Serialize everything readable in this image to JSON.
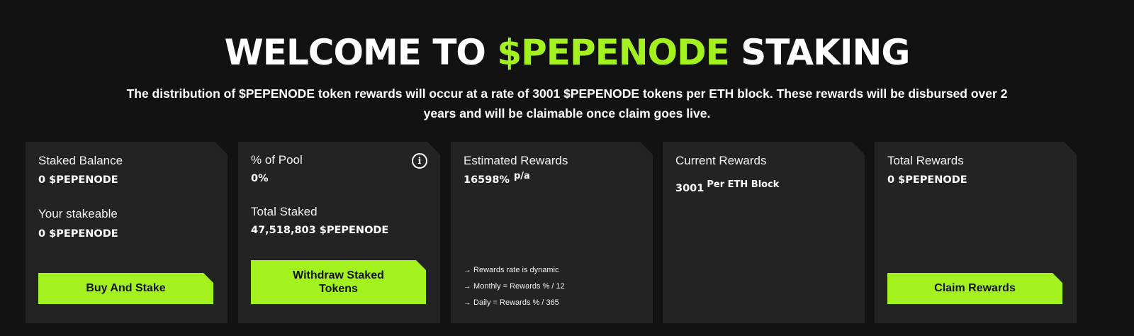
{
  "header": {
    "title_prefix": "WELCOME TO",
    "title_accent": "$PEPENODE",
    "title_suffix": "STAKING",
    "description": "The distribution of $PEPENODE token rewards will occur at a rate of 3001 $PEPENODE tokens per ETH block. These rewards will be disbursed over 2 years and will be claimable once claim goes live."
  },
  "cards": {
    "staked": {
      "balance_label": "Staked Balance",
      "balance_value": "0 $PEPENODE",
      "stakeable_label": "Your stakeable",
      "stakeable_value": "0 $PEPENODE",
      "button_label": "Buy And Stake"
    },
    "pool": {
      "percent_label": "% of Pool",
      "percent_value": "0%",
      "total_label": "Total Staked",
      "total_value": "47,518,803 $PEPENODE",
      "button_label": "Withdraw Staked Tokens",
      "info_icon": "i"
    },
    "estimated": {
      "label": "Estimated Rewards",
      "value": "16598%",
      "unit": "p/a",
      "notes": [
        "→ Rewards rate is dynamic",
        "→ Monthly = Rewards % / 12",
        "→ Daily = Rewards % / 365"
      ]
    },
    "current": {
      "label": "Current Rewards",
      "value": "3001",
      "unit": "Per ETH Block"
    },
    "total": {
      "label": "Total Rewards",
      "value": "0 $PEPENODE",
      "button_label": "Claim Rewards"
    }
  },
  "colors": {
    "accent": "#a3f21f",
    "background": "#121212",
    "card": "#232323"
  }
}
